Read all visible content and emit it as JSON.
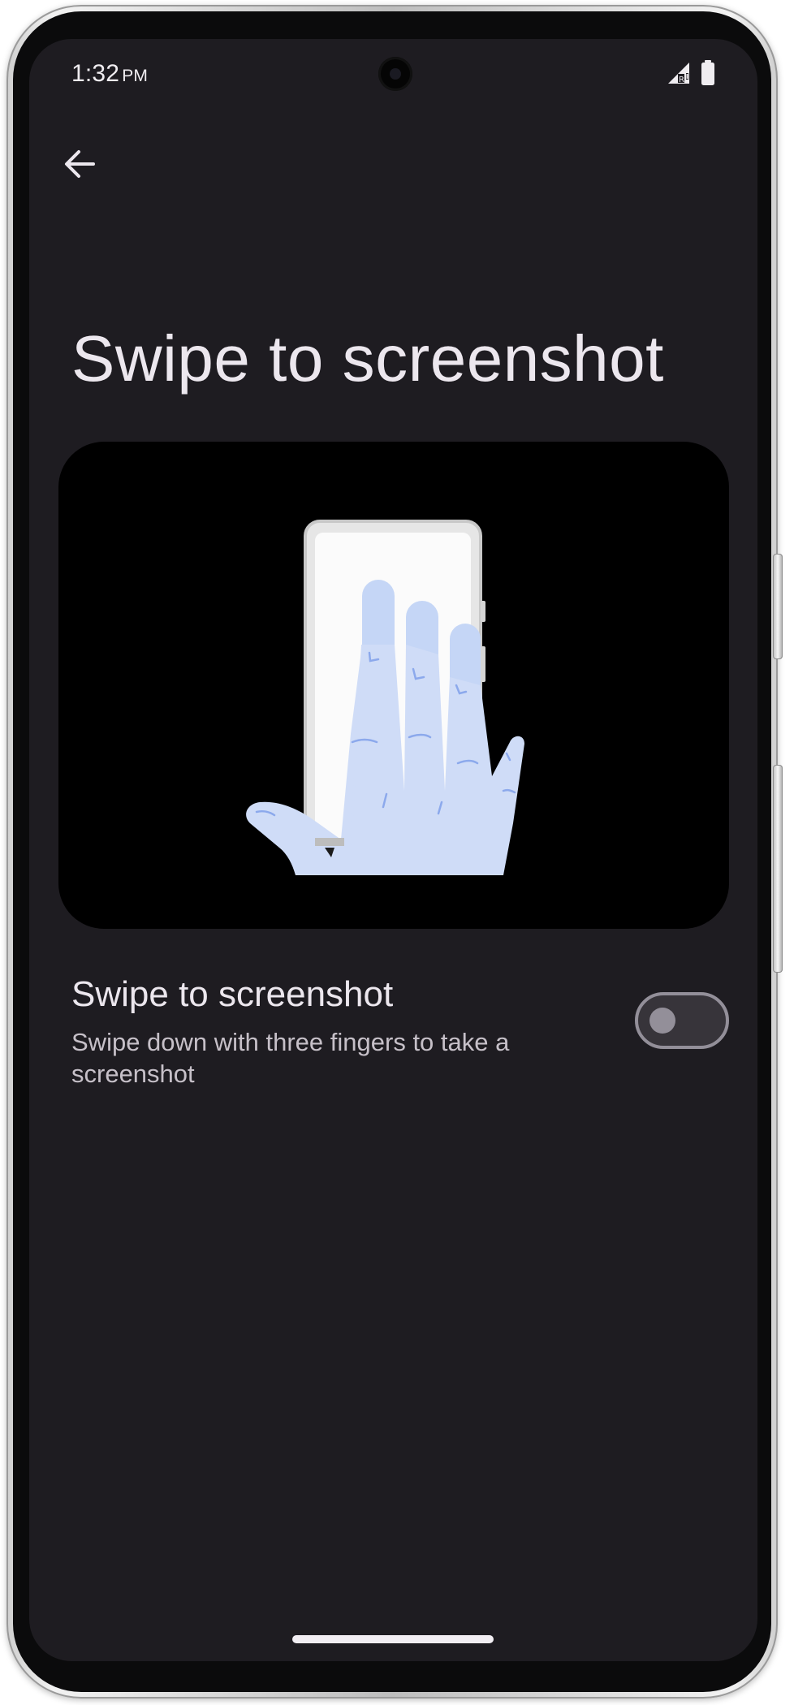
{
  "status_bar": {
    "time": "1:32",
    "ampm": "PM",
    "icons": [
      "signal-roaming-icon",
      "battery-icon"
    ]
  },
  "header": {
    "back_icon": "arrow-back-icon"
  },
  "page": {
    "title": "Swipe to screenshot"
  },
  "illustration": {
    "icon": "three-finger-swipe-hand-illustration"
  },
  "setting": {
    "title": "Swipe to screenshot",
    "summary": "Swipe down with three fingers to take a screenshot",
    "toggle_on": false
  },
  "colors": {
    "screen_background": "#1e1c21",
    "illustration_background": "#000000",
    "hand": "#cfdcf7",
    "toggle_track": "#37343a",
    "toggle_outline": "#938f99"
  }
}
